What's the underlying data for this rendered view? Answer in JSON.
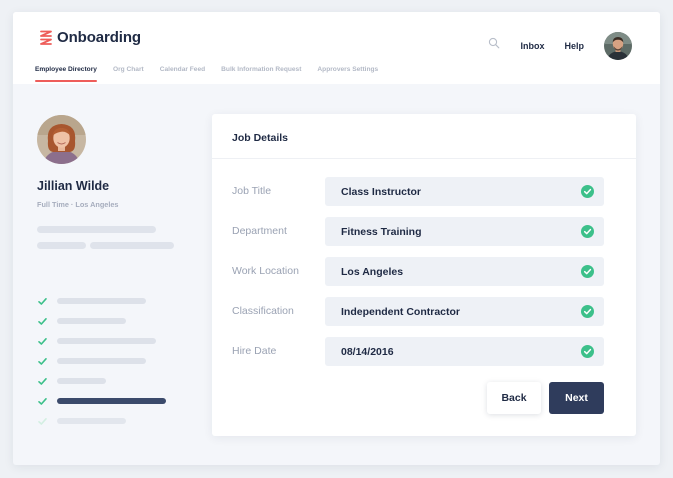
{
  "brand": {
    "name": "Onboarding",
    "logo_icon": "stacked-chevrons-logo",
    "logo_color": "#ee5d5a"
  },
  "tabs": [
    {
      "label": "Employee Directory",
      "active": true
    },
    {
      "label": "Org Chart",
      "active": false
    },
    {
      "label": "Calendar Feed",
      "active": false
    },
    {
      "label": "Bulk Information Request",
      "active": false
    },
    {
      "label": "Approvers Settings",
      "active": false
    }
  ],
  "header": {
    "search_icon": "search-icon",
    "inbox_label": "Inbox",
    "help_label": "Help",
    "user_avatar": "user-avatar"
  },
  "profile": {
    "name": "Jillian Wilde",
    "subtitle": "Full Time · Los Angeles"
  },
  "checklist": [
    {
      "done": true
    },
    {
      "done": true
    },
    {
      "done": true
    },
    {
      "done": true
    },
    {
      "done": true
    },
    {
      "done": true,
      "current": true
    },
    {
      "done": false
    }
  ],
  "card": {
    "title": "Job Details",
    "fields": [
      {
        "label": "Job Title",
        "value": "Class Instructor",
        "valid": true
      },
      {
        "label": "Department",
        "value": "Fitness Training",
        "valid": true
      },
      {
        "label": "Work Location",
        "value": "Los Angeles",
        "valid": true
      },
      {
        "label": "Classification",
        "value": "Independent Contractor",
        "valid": true
      },
      {
        "label": "Hire Date",
        "value": "08/14/2016",
        "valid": true
      }
    ],
    "back_label": "Back",
    "next_label": "Next"
  },
  "colors": {
    "accent": "#ee5d5a",
    "success": "#3cc08a",
    "primary": "#2f3c5c",
    "text": "#1f2a44"
  }
}
